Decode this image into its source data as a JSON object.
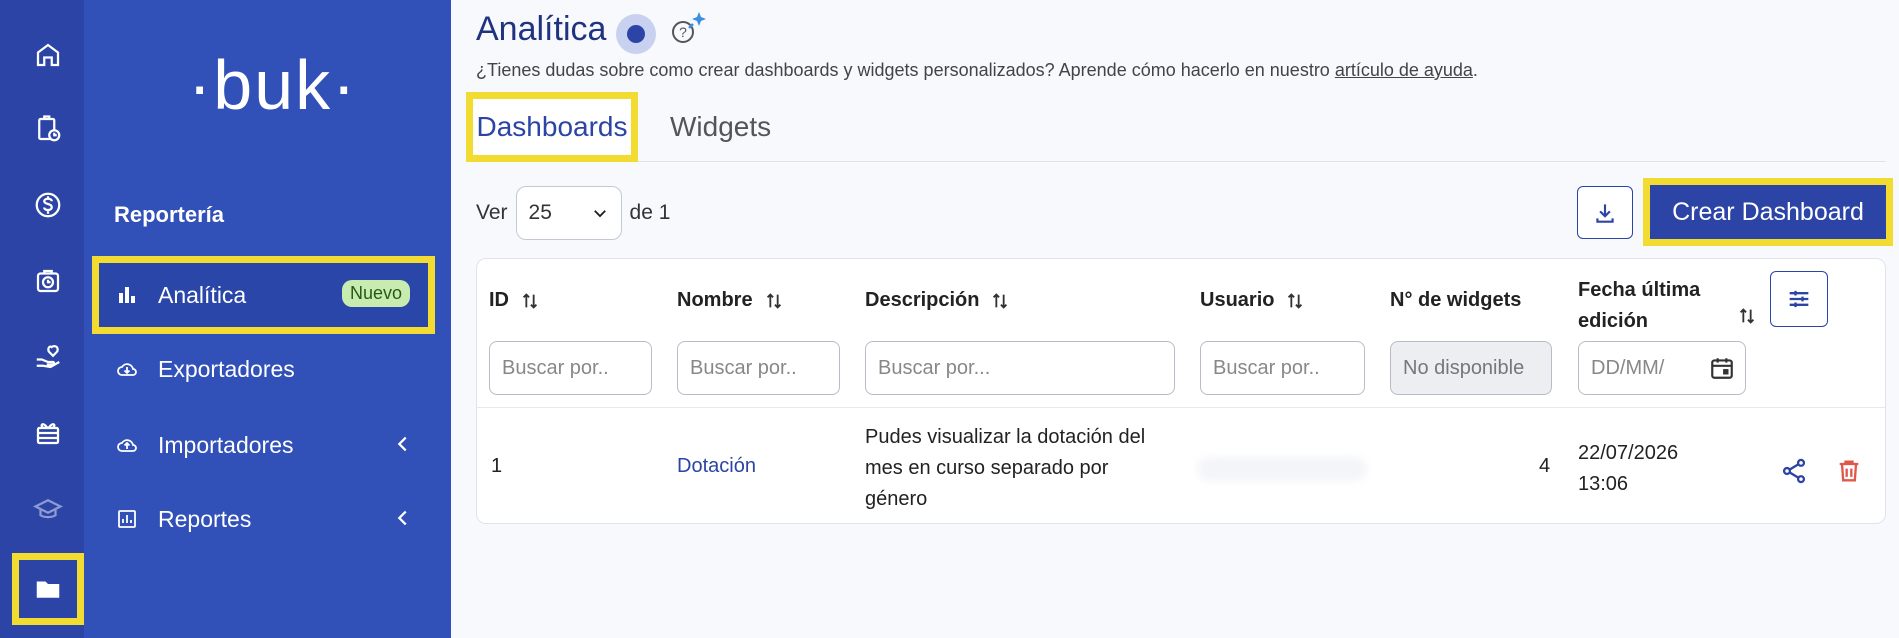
{
  "rail": {
    "icons": [
      "home-icon",
      "clipboard-clock-icon",
      "dollar-icon",
      "briefcase-clock-icon",
      "hand-heart-icon",
      "gift-icon",
      "graduation-cap-icon",
      "folder-icon"
    ]
  },
  "sidebar": {
    "logo": "·buk·",
    "section_title": "Reportería",
    "items": [
      {
        "label": "Analítica",
        "icon": "bar-chart-icon",
        "badge": "Nuevo",
        "active": true
      },
      {
        "label": "Exportadores",
        "icon": "cloud-download-icon"
      },
      {
        "label": "Importadores",
        "icon": "cloud-upload-icon",
        "chevron": true
      },
      {
        "label": "Reportes",
        "icon": "report-icon",
        "chevron": true
      }
    ]
  },
  "header": {
    "title": "Analítica",
    "subtitle_prefix": "¿Tienes dudas sobre como crear dashboards y widgets personalizados? Aprende cómo hacerlo en nuestro ",
    "subtitle_link": "artículo de ayuda",
    "subtitle_suffix": "."
  },
  "tabs": [
    {
      "label": "Dashboards",
      "active": true
    },
    {
      "label": "Widgets",
      "active": false
    }
  ],
  "pagination": {
    "ver_label": "Ver",
    "per_page": "25",
    "of_label": "de 1"
  },
  "actions": {
    "create_label": "Crear Dashboard"
  },
  "table": {
    "columns": [
      {
        "label": "ID",
        "placeholder": "Buscar por.."
      },
      {
        "label": "Nombre",
        "placeholder": "Buscar por.."
      },
      {
        "label": "Descripción",
        "placeholder": "Buscar por..."
      },
      {
        "label": "Usuario",
        "placeholder": "Buscar por.."
      },
      {
        "label": "N° de widgets",
        "placeholder": "No disponible"
      },
      {
        "label_line1": "Fecha última",
        "label_line2": "edición",
        "placeholder": "DD/MM/"
      }
    ],
    "rows": [
      {
        "id": "1",
        "nombre": "Dotación",
        "descripcion_line1": "Pudes visualizar la dotación del",
        "descripcion_line2": "mes en curso separado por",
        "descripcion_line3": "género",
        "widgets": "4",
        "fecha_line1": "22/07/2026",
        "fecha_line2": "13:06"
      }
    ]
  },
  "colors": {
    "primary": "#2b44a5",
    "sidebar": "#3150b8",
    "highlight": "#f2dc31",
    "badge_bg": "#c8ecb0",
    "delete": "#e0574b"
  }
}
